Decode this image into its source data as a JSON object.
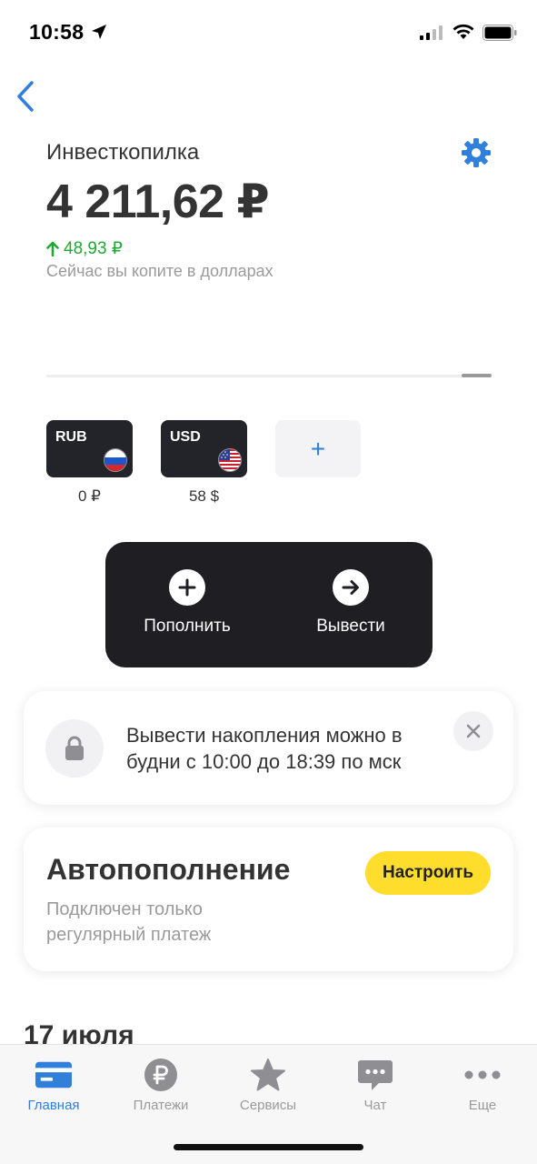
{
  "status_bar": {
    "time": "10:58"
  },
  "header": {
    "title": "Инвесткопилка",
    "balance": "4 211,62 ₽",
    "change": "48,93 ₽",
    "subtitle": "Сейчас вы копите в долларах"
  },
  "currencies": [
    {
      "code": "RUB",
      "amount": "0 ₽",
      "flag": "russia-flag"
    },
    {
      "code": "USD",
      "amount": "58 $",
      "flag": "usa-flag"
    }
  ],
  "add_currency_label": "+",
  "actions": {
    "deposit_label": "Пополнить",
    "withdraw_label": "Вывести"
  },
  "notice": {
    "line1": "Вывести накопления можно в",
    "line2": "будни с 10:00 до 18:39 по мск"
  },
  "autopay": {
    "title": "Автопополнение",
    "description": "Подключен только регулярный платеж",
    "button_label": "Настроить"
  },
  "history": {
    "date_heading": "17 июля"
  },
  "tab_bar": {
    "tabs": [
      {
        "label": "Главная",
        "icon": "card-icon",
        "active": true
      },
      {
        "label": "Платежи",
        "icon": "ruble-icon",
        "active": false
      },
      {
        "label": "Сервисы",
        "icon": "star-icon",
        "active": false
      },
      {
        "label": "Чат",
        "icon": "chat-icon",
        "active": false
      },
      {
        "label": "Еще",
        "icon": "more-icon",
        "active": false
      }
    ]
  },
  "colors": {
    "accent_blue": "#2f7fdb",
    "positive_green": "#1fa835",
    "brand_yellow": "#ffdd2d",
    "dark_panel": "#1f1f23"
  }
}
